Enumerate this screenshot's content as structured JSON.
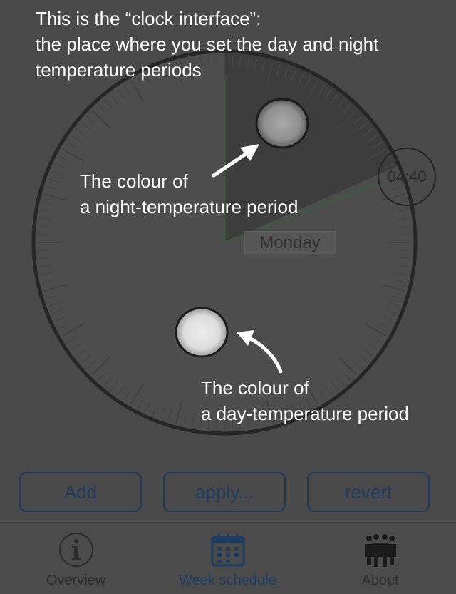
{
  "intro": {
    "line1": "This is the “clock interface”:",
    "line2": "the place where you set the day and night",
    "line3": "temperature periods"
  },
  "callouts": {
    "night": {
      "line1": "The colour of",
      "line2": "a night-temperature period"
    },
    "day": {
      "line1": "The colour of",
      "line2": "a day-temperature period"
    }
  },
  "clock": {
    "time": "04:40",
    "day": "Monday"
  },
  "buttons": {
    "add": "Add",
    "apply": "apply...",
    "revert": "revert"
  },
  "tabs": [
    {
      "label": "Overview",
      "icon": "info-icon",
      "selected": false
    },
    {
      "label": "Week schedule",
      "icon": "calendar-icon",
      "selected": true
    },
    {
      "label": "About",
      "icon": "people-icon",
      "selected": false
    }
  ],
  "colors": {
    "overlay_background": "#4a4a4a",
    "night_period": "#3b3b3b",
    "night_marker": "#9a9a9a",
    "day_marker": "#e2e2e2",
    "accent_blue": "#1e3d63",
    "period_edge_green": "#3e5a3e"
  }
}
